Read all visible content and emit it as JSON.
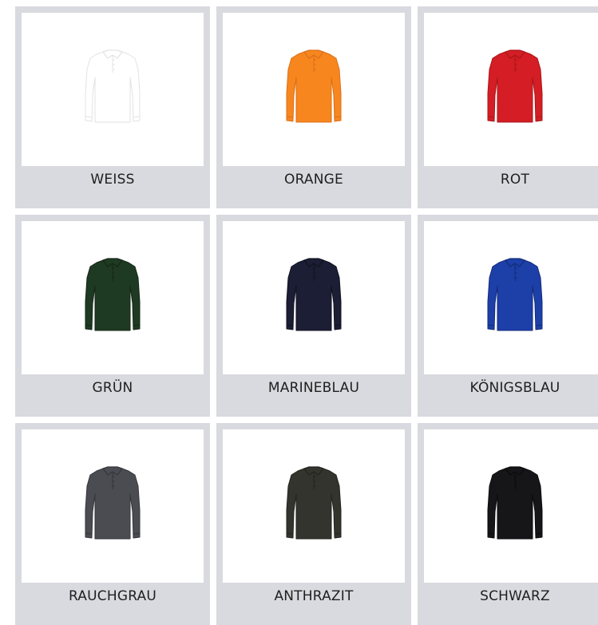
{
  "swatches": [
    {
      "label": "WEISS",
      "color": "#ffffff",
      "stroke": "#e3e3e3"
    },
    {
      "label": "ORANGE",
      "color": "#f7861e",
      "stroke": "#d9701a"
    },
    {
      "label": "ROT",
      "color": "#d41d24",
      "stroke": "#a8161c"
    },
    {
      "label": "GRÜN",
      "color": "#1f3a22",
      "stroke": "#142616"
    },
    {
      "label": "MARINEBLAU",
      "color": "#1b1e34",
      "stroke": "#11131f"
    },
    {
      "label": "KÖNIGSBLAU",
      "color": "#1d3fa8",
      "stroke": "#132b78"
    },
    {
      "label": "RAUCHGRAU",
      "color": "#4a4c52",
      "stroke": "#35363b"
    },
    {
      "label": "ANTHRAZIT",
      "color": "#34342f",
      "stroke": "#24241f"
    },
    {
      "label": "SCHWARZ",
      "color": "#161618",
      "stroke": "#0b0b0c"
    }
  ]
}
